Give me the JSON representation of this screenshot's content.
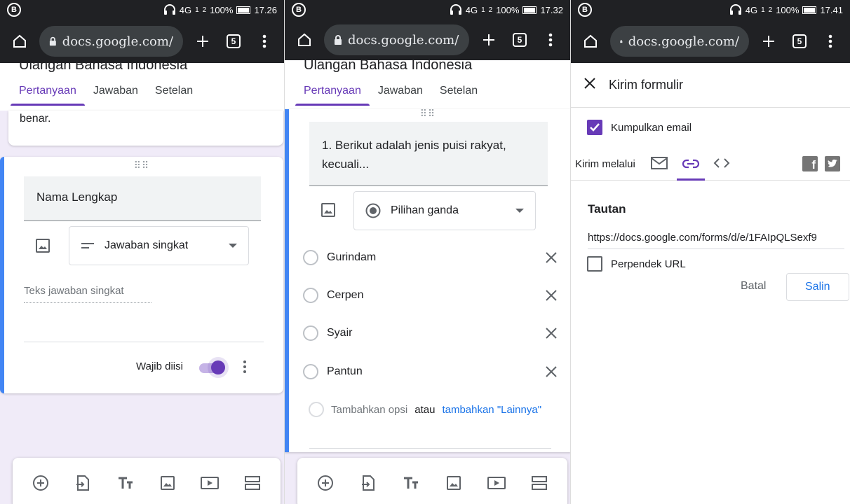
{
  "panels": [
    {
      "status": {
        "left_icon": "B",
        "network": "4G",
        "sim1": "1",
        "sim2": "2",
        "battery": "100%",
        "time": "17.26"
      },
      "chrome": {
        "url": "docs.google.com/",
        "tab_count": "5"
      },
      "form": {
        "title": "Ulangan Bahasa Indonesia",
        "tabs": [
          "Pertanyaan",
          "Jawaban",
          "Setelan"
        ]
      },
      "prev_card_text": "benar.",
      "question": {
        "title": "Nama Lengkap",
        "type_label": "Jawaban singkat",
        "answer_placeholder": "Teks jawaban singkat",
        "required_label": "Wajib diisi"
      }
    },
    {
      "status": {
        "left_icon": "B",
        "network": "4G",
        "sim1": "1",
        "sim2": "2",
        "battery": "100%",
        "time": "17.32"
      },
      "chrome": {
        "url": "docs.google.com/",
        "tab_count": "5"
      },
      "form": {
        "title": "Ulangan Bahasa Indonesia",
        "tabs": [
          "Pertanyaan",
          "Jawaban",
          "Setelan"
        ]
      },
      "question": {
        "title": "1. Berikut adalah jenis puisi rakyat, kecuali...",
        "type_label": "Pilihan ganda",
        "options": [
          "Gurindam",
          "Cerpen",
          "Syair",
          "Pantun"
        ],
        "add_option": "Tambahkan opsi",
        "or_label": "atau",
        "add_other": "tambahkan \"Lainnya\""
      }
    },
    {
      "status": {
        "left_icon": "B",
        "network": "4G",
        "sim1": "1",
        "sim2": "2",
        "battery": "100%",
        "time": "17.41"
      },
      "chrome": {
        "url": "docs.google.com/",
        "tab_count": "5"
      },
      "dialog": {
        "title": "Kirim formulir",
        "collect_email": "Kumpulkan email",
        "send_via": "Kirim melalui",
        "link_heading": "Tautan",
        "link_url": "https://docs.google.com/forms/d/e/1FAIpQLSexf9",
        "shorten_url": "Perpendek URL",
        "cancel": "Batal",
        "copy": "Salin"
      }
    }
  ],
  "colors": {
    "accent": "#673ab7",
    "link": "#1a73e8",
    "question_bar": "#4285f4",
    "background": "#f0ebf8"
  }
}
